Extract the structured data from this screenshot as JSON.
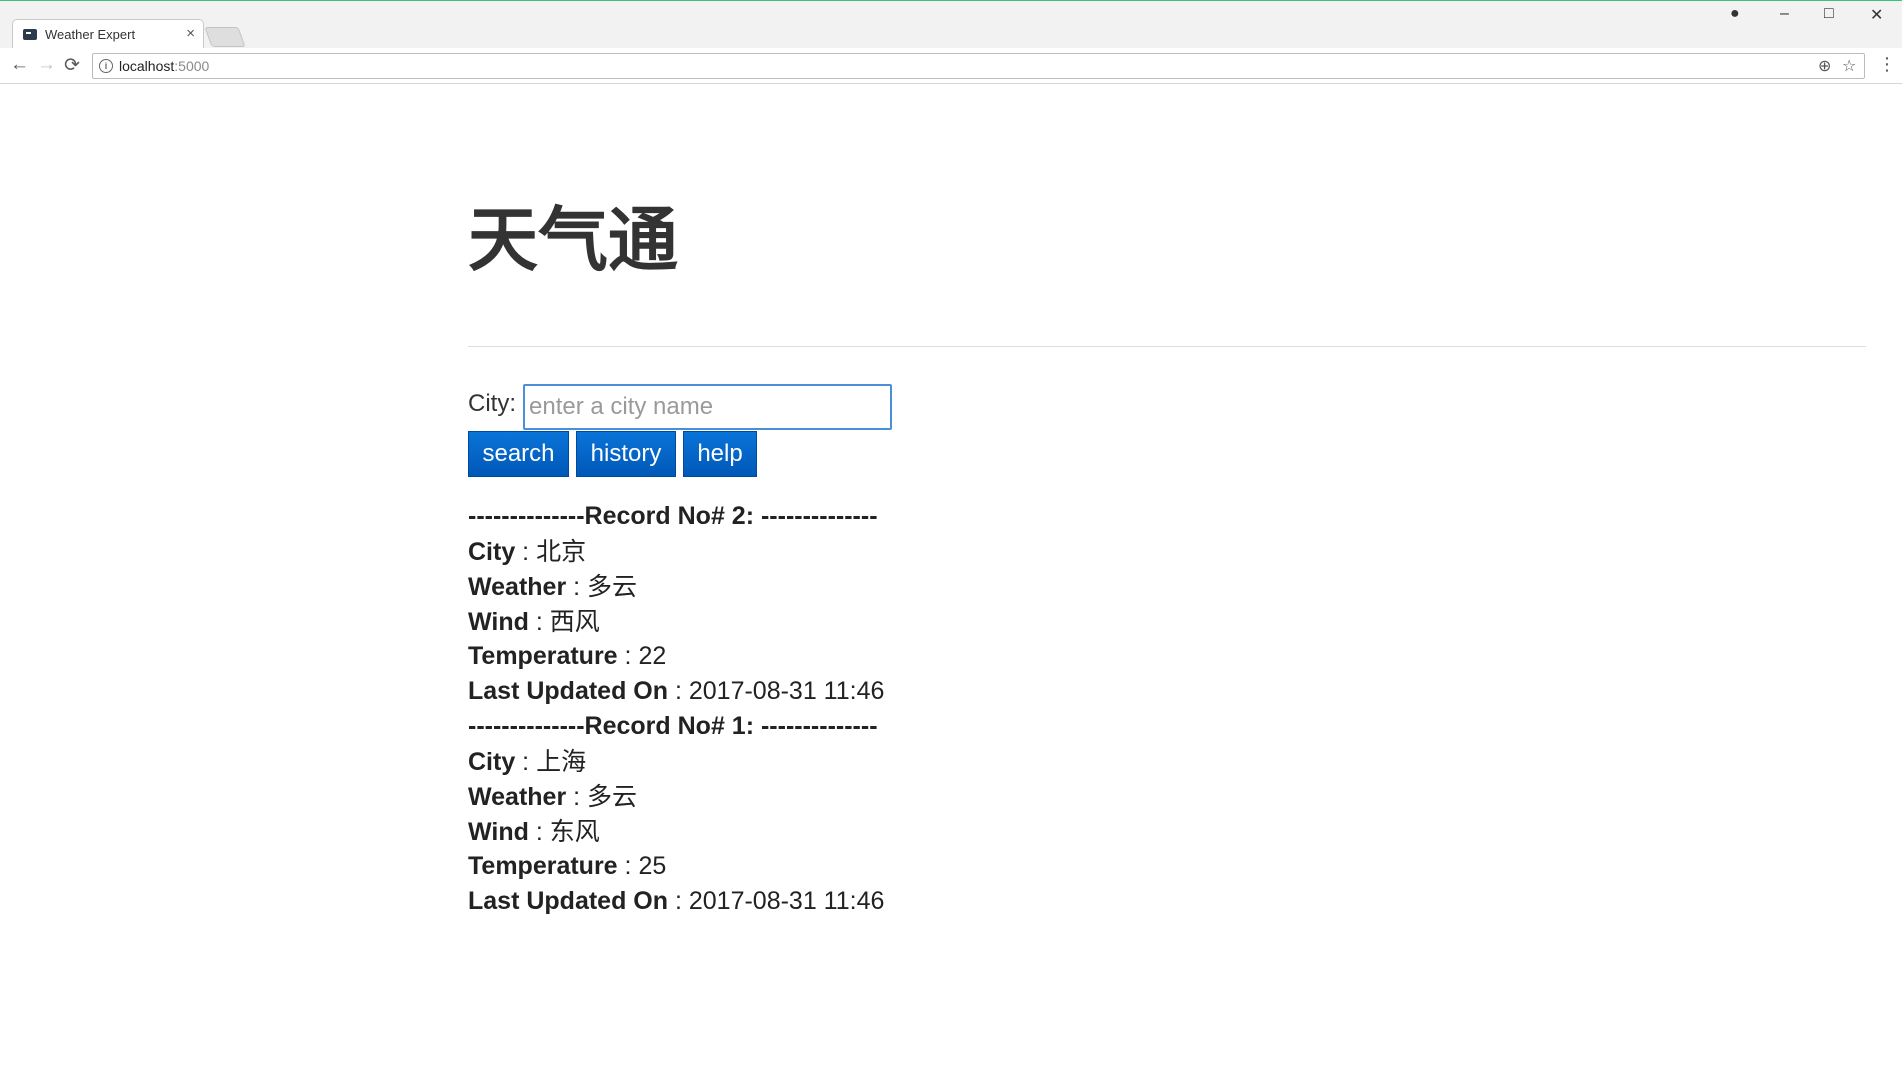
{
  "browser": {
    "tab_title": "Weather Expert",
    "tab_close": "×",
    "url_host": "localhost",
    "url_port": ":5000",
    "icons": {
      "back": "←",
      "forward": "→",
      "reload": "⟳",
      "zoom": "⊕",
      "star": "☆",
      "menu": "⋮",
      "account": "●",
      "minimize": "–",
      "maximize": "□",
      "close": "✕",
      "info": "i"
    }
  },
  "page": {
    "title": "天气通",
    "city_label": "City:",
    "city_input": {
      "value": "",
      "placeholder": "enter a city name"
    },
    "buttons": {
      "search": "search",
      "history": "history",
      "help": "help"
    },
    "button_color": "#0065c8",
    "records": [
      {
        "header": "--------------Record No# 2: --------------",
        "city_label": "City",
        "city": "北京",
        "weather_label": "Weather",
        "weather": "多云",
        "wind_label": "Wind",
        "wind": "西风",
        "temperature_label": "Temperature",
        "temperature": "22",
        "updated_label": "Last Updated On",
        "updated": "2017-08-31 11:46"
      },
      {
        "header": "--------------Record No# 1: --------------",
        "city_label": "City",
        "city": "上海",
        "weather_label": "Weather",
        "weather": "多云",
        "wind_label": "Wind",
        "wind": "东风",
        "temperature_label": "Temperature",
        "temperature": "25",
        "updated_label": "Last Updated On",
        "updated": "2017-08-31 11:46"
      }
    ]
  }
}
